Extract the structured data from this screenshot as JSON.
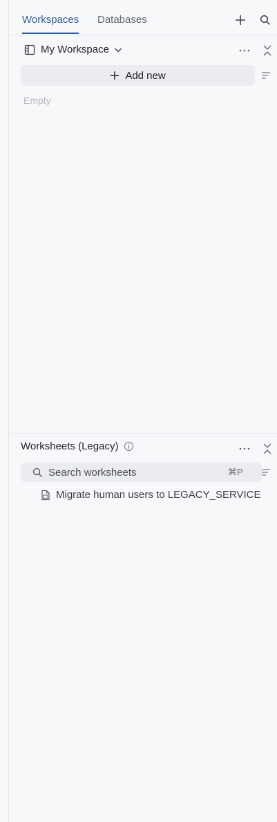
{
  "tabs": [
    {
      "label": "Workspaces",
      "active": true
    },
    {
      "label": "Databases",
      "active": false
    }
  ],
  "header_icons": [
    "plus-icon",
    "search-icon"
  ],
  "workspace": {
    "title": "My Workspace",
    "add_label": "Add new",
    "empty_text": "Empty"
  },
  "worksheets": {
    "title": "Worksheets (Legacy)",
    "search_placeholder": "Search worksheets",
    "search_shortcut": "⌘P",
    "items": [
      {
        "label": "Migrate human users to LEGACY_SERVICE"
      }
    ]
  },
  "colors": {
    "accent": "#2f5d9e",
    "panel_bg": "#f7f8fa",
    "button_bg": "#eaecef",
    "muted_text": "#b4b8bd"
  }
}
